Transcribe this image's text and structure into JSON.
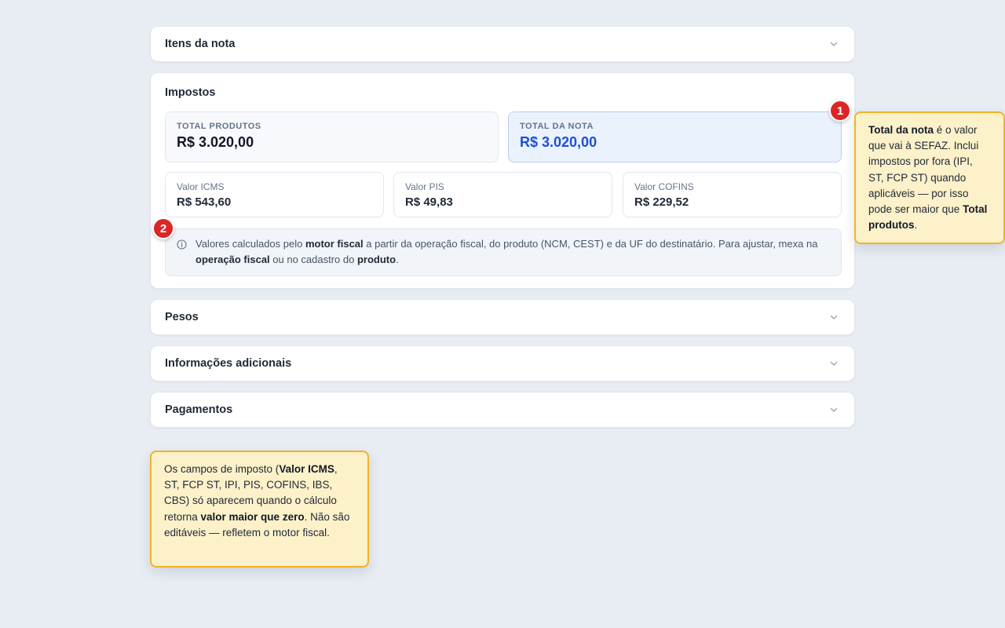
{
  "sections": {
    "itens": {
      "title": "Itens da nota"
    },
    "impostos": {
      "title": "Impostos",
      "total_produtos": {
        "label": "TOTAL PRODUTOS",
        "value": "R$ 3.020,00"
      },
      "total_nota": {
        "label": "TOTAL DA NOTA",
        "value": "R$ 3.020,00"
      },
      "taxes": [
        {
          "label": "Valor ICMS",
          "value": "R$ 543,60"
        },
        {
          "label": "Valor PIS",
          "value": "R$ 49,83"
        },
        {
          "label": "Valor COFINS",
          "value": "R$ 229,52"
        }
      ],
      "info": {
        "p1": "Valores calculados pelo ",
        "b1": "motor fiscal",
        "p2": " a partir da operação fiscal, do produto (NCM, CEST) e da UF do destinatário. Para ajustar, mexa na ",
        "b2": "operação fiscal",
        "p3": " ou no cadastro do ",
        "b3": "produto",
        "p4": "."
      }
    },
    "pesos": {
      "title": "Pesos"
    },
    "info_adicionais": {
      "title": "Informações adicionais"
    },
    "pagamentos": {
      "title": "Pagamentos"
    }
  },
  "annotations": {
    "badge1": "1",
    "badge2": "2",
    "note1": {
      "b1": "Total da nota",
      "p1": " é o valor que vai à SEFAZ. Inclui impostos por fora (IPI, ST, FCP ST) quando aplicáveis — por isso pode ser maior que ",
      "b2": "Total produtos",
      "p2": "."
    },
    "note2": {
      "p1": "Os campos de imposto (",
      "b1": "Valor ICMS",
      "p2": ", ST, FCP ST, IPI, PIS, COFINS, IBS, CBS) só aparecem quando o cálculo retorna ",
      "b2": "valor maior que zero",
      "p3": ". Não são editáveis — refletem o motor fiscal."
    }
  },
  "colors": {
    "background": "#e8ecf3",
    "accent_blue": "#1d4ed8",
    "badge_red": "#dc2626",
    "note_bg": "#fdf1c9",
    "note_border": "#f0b429"
  },
  "icons": [
    "chevron-down-icon",
    "info-icon"
  ]
}
